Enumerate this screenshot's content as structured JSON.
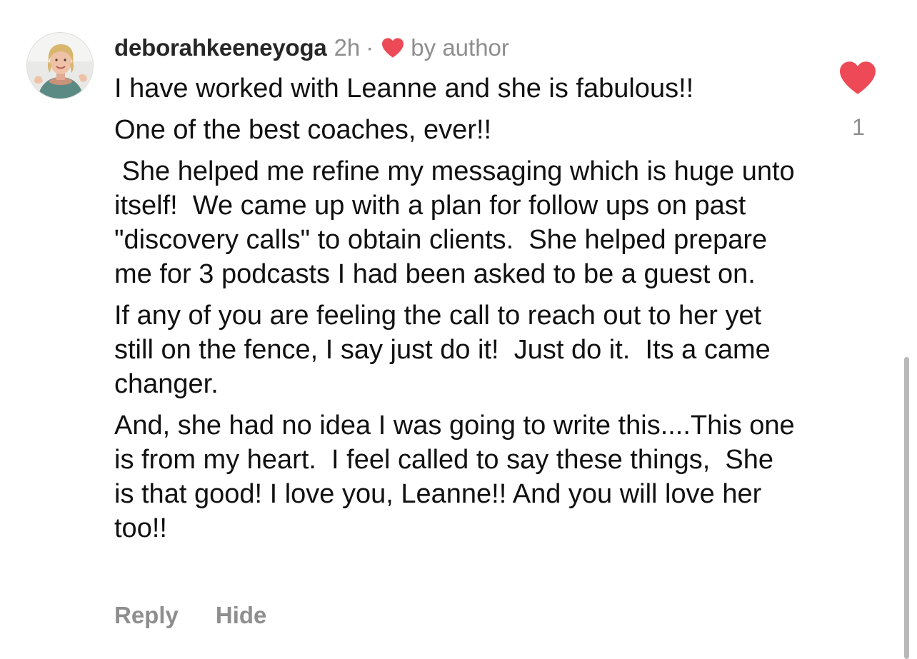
{
  "comment": {
    "username": "deborahkeeneyoga",
    "time": "2h",
    "separator": "·",
    "author_like_label": "by author",
    "paragraphs": [
      "I have worked with Leanne and she is fabulous!!",
      "One of the best coaches, ever!!",
      " She helped me refine my messaging which is huge unto itself!  We came up with a plan for follow ups on past \"discovery calls\" to obtain clients.  She helped prepare me for 3 podcasts I had been asked to be a guest on.",
      "If any of you are feeling the call to reach out to her yet still on the fence, I say just do it!  Just do it.  Its a came changer.",
      "And, she had no idea I was going to write this....This one is from my heart.  I feel called to say these things,  She is that good! I love you, Leanne!! And you will love her too!!"
    ],
    "like_count": "1"
  },
  "actions": {
    "reply_label": "Reply",
    "hide_label": "Hide"
  },
  "icons": {
    "avatar": "profile-photo",
    "author_like": "heart-icon",
    "like_button": "heart-filled-icon"
  },
  "colors": {
    "heart": "#ed4956",
    "muted_text": "#8e8e8e",
    "body_text": "#111111",
    "username": "#262626"
  }
}
